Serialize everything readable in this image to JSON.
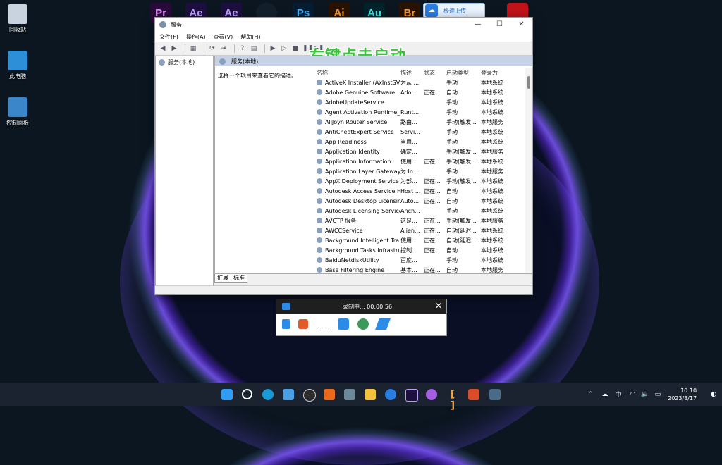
{
  "desktop": {
    "icons": [
      {
        "label": "回收站"
      },
      {
        "label": "此电脑"
      },
      {
        "label": "控制面板"
      }
    ],
    "top_apps": [
      "Pr",
      "Ae",
      "Ae",
      "",
      "Ps",
      "Ai",
      "Au",
      "Br"
    ],
    "upload_label": "极速上传"
  },
  "window": {
    "title": "服务",
    "menu": [
      "文件(F)",
      "操作(A)",
      "查看(V)",
      "帮助(H)"
    ],
    "overlay_text": "右键点击启动",
    "tree_node": "服务(本地)",
    "header": "服务(本地)",
    "description_hint": "选择一个项目来查看它的描述。",
    "columns": [
      "名称",
      "描述",
      "状态",
      "启动类型",
      "登录为"
    ],
    "rows": [
      [
        "ActiveX Installer (AxInstSV)",
        "为从 ...",
        "",
        "手动",
        "本地系统"
      ],
      [
        "Adobe Genuine Software ...",
        "Ado...",
        "正在...",
        "自动",
        "本地系统"
      ],
      [
        "AdobeUpdateService",
        "",
        "",
        "手动",
        "本地系统"
      ],
      [
        "Agent Activation Runtime_...",
        "Runt...",
        "",
        "手动",
        "本地系统"
      ],
      [
        "AllJoyn Router Service",
        "路由...",
        "",
        "手动(触发...",
        "本地服务"
      ],
      [
        "AntiCheatExpert Service",
        "Servi...",
        "",
        "手动",
        "本地系统"
      ],
      [
        "App Readiness",
        "当用...",
        "",
        "手动",
        "本地系统"
      ],
      [
        "Application Identity",
        "确定...",
        "",
        "手动(触发...",
        "本地服务"
      ],
      [
        "Application Information",
        "使用...",
        "正在...",
        "手动(触发...",
        "本地系统"
      ],
      [
        "Application Layer Gateway ...",
        "为 In...",
        "",
        "手动",
        "本地服务"
      ],
      [
        "AppX Deployment Service ...",
        "为部...",
        "正在...",
        "手动(触发...",
        "本地系统"
      ],
      [
        "Autodesk Access Service H...",
        "Host ...",
        "正在...",
        "自动",
        "本地系统"
      ],
      [
        "Autodesk Desktop Licensin...",
        "Auto...",
        "正在...",
        "自动",
        "本地系统"
      ],
      [
        "Autodesk Licensing Service",
        "Anch...",
        "",
        "手动",
        "本地系统"
      ],
      [
        "AVCTP 服务",
        "这是...",
        "正在...",
        "手动(触发...",
        "本地服务"
      ],
      [
        "AWCCService",
        "Alien...",
        "正在...",
        "自动(延迟...",
        "本地系统"
      ],
      [
        "Background Intelligent Tra...",
        "使用...",
        "正在...",
        "自动(延迟...",
        "本地系统"
      ],
      [
        "Background Tasks Infrastru...",
        "控制...",
        "正在...",
        "自动",
        "本地系统"
      ],
      [
        "BaiduNetdiskUtility",
        "百度...",
        "",
        "手动",
        "本地系统"
      ],
      [
        "Base Filtering Engine",
        "基本...",
        "正在...",
        "自动",
        "本地服务"
      ]
    ],
    "tabs": [
      "扩展",
      "标准"
    ]
  },
  "recorder": {
    "status": "录制中... 00:00:56"
  },
  "taskbar": {
    "ime": "中",
    "time": "10:10",
    "date": "2023/8/17"
  }
}
